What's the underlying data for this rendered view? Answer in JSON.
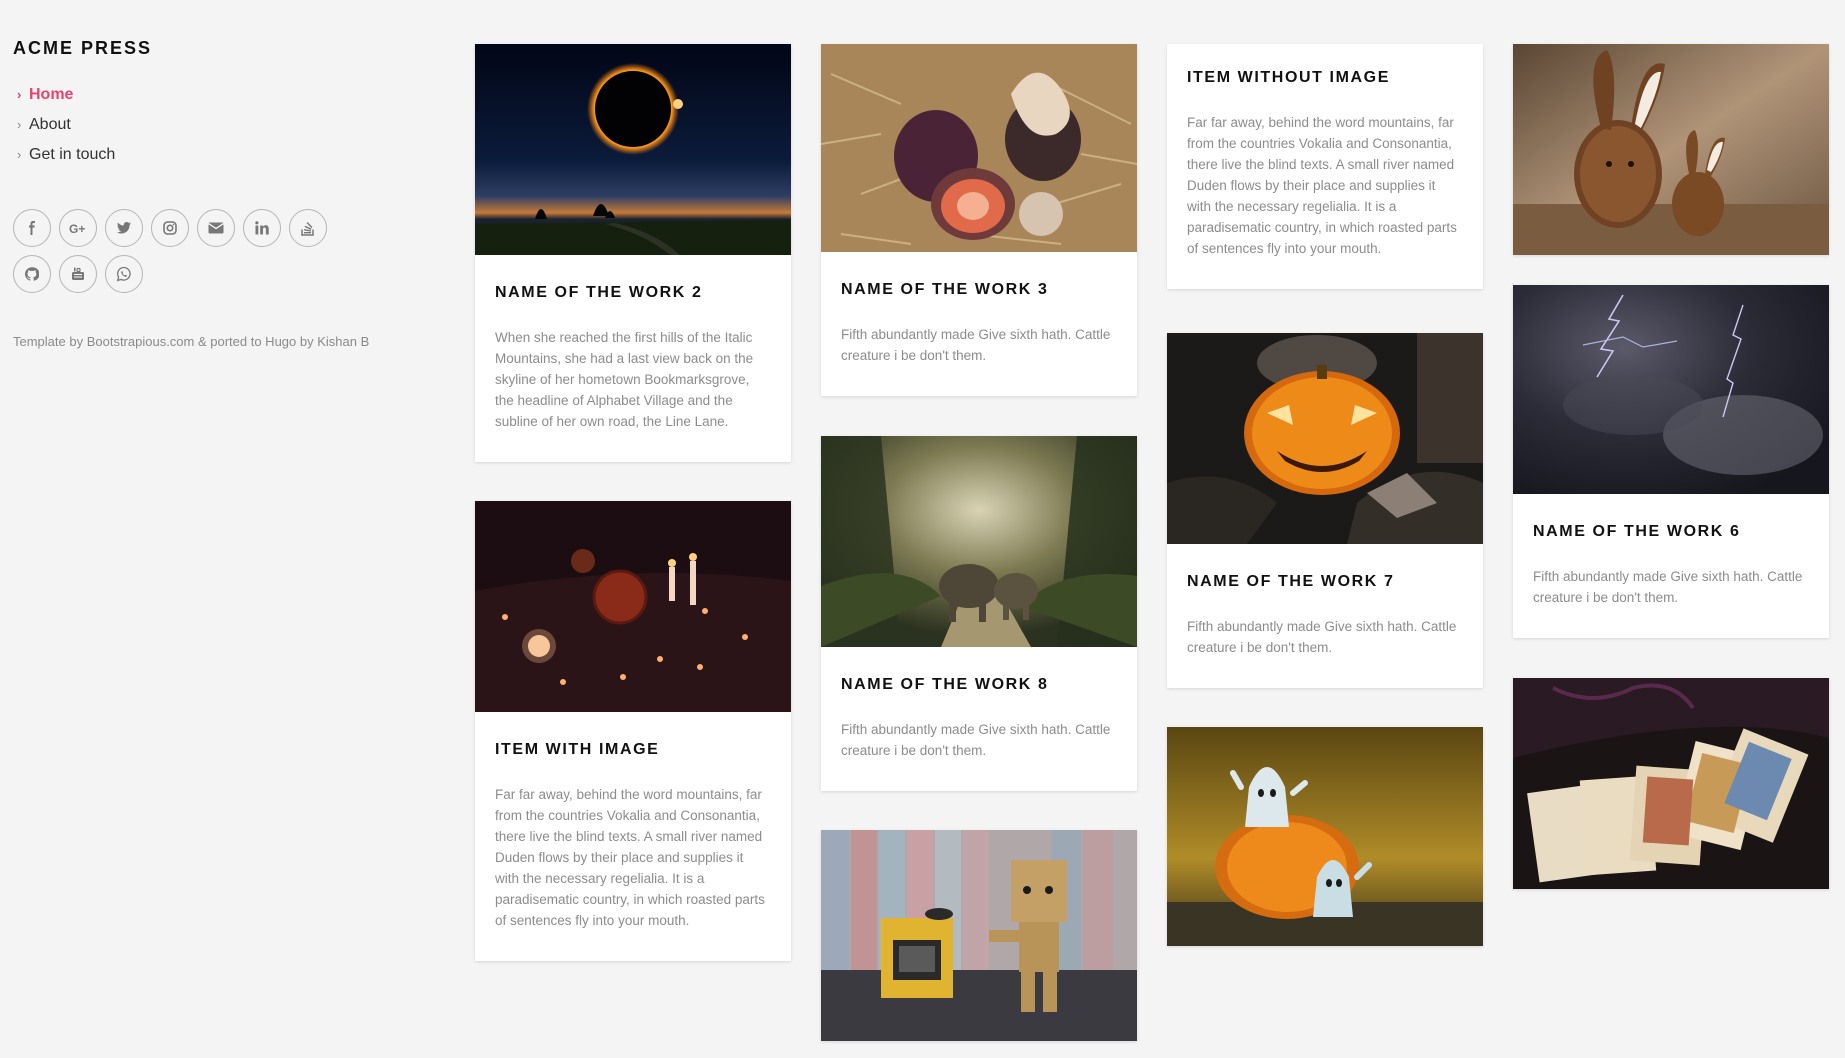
{
  "brand": "ACME PRESS",
  "nav": [
    {
      "label": "Home",
      "active": true
    },
    {
      "label": "About",
      "active": false
    },
    {
      "label": "Get in touch",
      "active": false
    }
  ],
  "socials": [
    "facebook-icon",
    "google-plus-icon",
    "twitter-icon",
    "instagram-icon",
    "envelope-icon",
    "linkedin-icon",
    "stack-overflow-icon",
    "github-icon",
    "youtube-icon",
    "whatsapp-icon"
  ],
  "credit": "Template by Bootstrapious.com & ported to Hugo by Kishan B",
  "colors": {
    "accent": "#e8446e",
    "background": "#f4f4f4",
    "card": "#ffffff"
  },
  "cards": {
    "work2": {
      "title": "NAME OF THE WORK 2",
      "text": "When she reached the first hills of the Italic Mountains, she had a last view back on the skyline of her hometown Bookmarksgrove, the headline of Alphabet Village and the subline of her own road, the Line Lane."
    },
    "item_with_image": {
      "title": "ITEM WITH IMAGE",
      "text": "Far far away, behind the word mountains, far from the countries Vokalia and Consonantia, there live the blind texts. A small river named Duden flows by their place and supplies it with the necessary regelialia. It is a paradisematic country, in which roasted parts of sentences fly into your mouth."
    },
    "work3": {
      "title": "NAME OF THE WORK 3",
      "text": "Fifth abundantly made Give sixth hath. Cattle creature i be don't them."
    },
    "work8": {
      "title": "NAME OF THE WORK 8",
      "text": "Fifth abundantly made Give sixth hath. Cattle creature i be don't them."
    },
    "item_without_image": {
      "title": "ITEM WITHOUT IMAGE",
      "text": "Far far away, behind the word mountains, far from the countries Vokalia and Consonantia, there live the blind texts. A small river named Duden flows by their place and supplies it with the necessary regelialia. It is a paradisematic country, in which roasted parts of sentences fly into your mouth."
    },
    "work7": {
      "title": "NAME OF THE WORK 7",
      "text": "Fifth abundantly made Give sixth hath. Cattle creature i be don't them."
    },
    "work6": {
      "title": "NAME OF THE WORK 6",
      "text": "Fifth abundantly made Give sixth hath. Cattle creature i be don't them."
    }
  }
}
